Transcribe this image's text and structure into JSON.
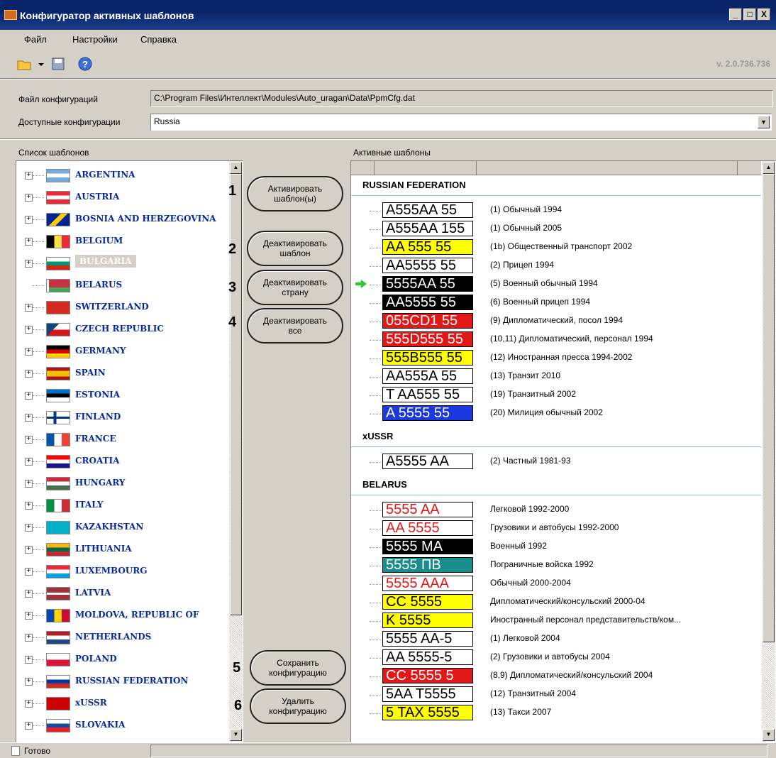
{
  "window": {
    "title": "Конфигуратор активных шаблонов",
    "min": "_",
    "max": "□",
    "close": "X"
  },
  "menu": [
    {
      "label": "Файл"
    },
    {
      "label": "Настройки"
    },
    {
      "label": "Справка"
    }
  ],
  "toolbar": {
    "version": "v. 2.0.736.736"
  },
  "config": {
    "file_label": "Файл конфигураций",
    "file_value": "C:\\Program Files\\Интеллект\\Modules\\Auto_uragan\\Data\\PpmCfg.dat",
    "available_label": "Доступные конфигурации",
    "available_value": "Russia"
  },
  "templates": {
    "label": "Список шаблонов",
    "items": [
      {
        "name": "ARGENTINA",
        "flag": "argentina",
        "expandable": true
      },
      {
        "name": "AUSTRIA",
        "flag": "austria",
        "expandable": true
      },
      {
        "name": "BOSNIA AND HERZEGOVINA",
        "flag": "bosnia",
        "expandable": true
      },
      {
        "name": "BELGIUM",
        "flag": "belgium",
        "expandable": true
      },
      {
        "name": "BULGARIA",
        "flag": "bulgaria",
        "expandable": true,
        "selected": true
      },
      {
        "name": "BELARUS",
        "flag": "belarus",
        "expandable": false
      },
      {
        "name": "SWITZERLAND",
        "flag": "switzerland",
        "expandable": true
      },
      {
        "name": "CZECH REPUBLIC",
        "flag": "czech",
        "expandable": true
      },
      {
        "name": "GERMANY",
        "flag": "germany",
        "expandable": true
      },
      {
        "name": "SPAIN",
        "flag": "spain",
        "expandable": true
      },
      {
        "name": "ESTONIA",
        "flag": "estonia",
        "expandable": true
      },
      {
        "name": "FINLAND",
        "flag": "finland",
        "expandable": true
      },
      {
        "name": "FRANCE",
        "flag": "france",
        "expandable": true
      },
      {
        "name": "CROATIA",
        "flag": "croatia",
        "expandable": true
      },
      {
        "name": "HUNGARY",
        "flag": "hungary",
        "expandable": true
      },
      {
        "name": "ITALY",
        "flag": "italy",
        "expandable": true
      },
      {
        "name": "KAZAKHSTAN",
        "flag": "kazakhstan",
        "expandable": true
      },
      {
        "name": "LITHUANIA",
        "flag": "lithuania",
        "expandable": true
      },
      {
        "name": "LUXEMBOURG",
        "flag": "luxembourg",
        "expandable": true
      },
      {
        "name": "LATVIA",
        "flag": "latvia",
        "expandable": true
      },
      {
        "name": "MOLDOVA, REPUBLIC OF",
        "flag": "moldova",
        "expandable": true
      },
      {
        "name": "NETHERLANDS",
        "flag": "netherlands",
        "expandable": true
      },
      {
        "name": "POLAND",
        "flag": "poland",
        "expandable": true
      },
      {
        "name": "RUSSIAN FEDERATION",
        "flag": "russia",
        "expandable": true
      },
      {
        "name": "xUSSR",
        "flag": "ussr",
        "expandable": true
      },
      {
        "name": "SLOVAKIA",
        "flag": "slovakia",
        "expandable": true
      }
    ]
  },
  "buttons": {
    "activate": "Активировать шаблон(ы)",
    "deactivate_template": "Деактивировать шаблон",
    "deactivate_country": "Деактивировать страну",
    "deactivate_all": "Деактивировать все",
    "save": "Сохранить конфигурацию",
    "delete": "Удалить конфигурацию"
  },
  "numbers": [
    "1",
    "2",
    "3",
    "4",
    "5",
    "6"
  ],
  "active": {
    "label": "Активные шаблоны",
    "groups": [
      {
        "title": "RUSSIAN FEDERATION",
        "items": [
          {
            "plate": "A555AA 55",
            "desc": "(1) Обычный 1994",
            "bg": "#ffffff",
            "fg": "#000000"
          },
          {
            "plate": "A555AA 155",
            "desc": "(1) Обычный 2005",
            "bg": "#ffffff",
            "fg": "#000000"
          },
          {
            "plate": "AA 555 55",
            "desc": "(1b) Общественный транспорт 2002",
            "bg": "#ffff00",
            "fg": "#000000"
          },
          {
            "plate": "AA5555 55",
            "desc": "(2) Прицеп 1994",
            "bg": "#ffffff",
            "fg": "#000000"
          },
          {
            "plate": "5555AA 55",
            "desc": "(5) Военный обычный 1994",
            "bg": "#000000",
            "fg": "#ffffff",
            "arrow": true
          },
          {
            "plate": "AA5555 55",
            "desc": "(6) Военный прицеп 1994",
            "bg": "#000000",
            "fg": "#ffffff"
          },
          {
            "plate": "055CD1 55",
            "desc": "(9) Дипломатический, посол 1994",
            "bg": "#e01818",
            "fg": "#ffffff"
          },
          {
            "plate": "555D555 55",
            "desc": "(10,11) Дипломатический, персонал 1994",
            "bg": "#e01818",
            "fg": "#ffffff"
          },
          {
            "plate": "555B555 55",
            "desc": "(12) Иностранная пресса 1994-2002",
            "bg": "#ffff00",
            "fg": "#000000"
          },
          {
            "plate": "AA555A 55",
            "desc": "(13) Транзит 2010",
            "bg": "#ffffff",
            "fg": "#000000"
          },
          {
            "plate": "T AA555 55",
            "desc": "(19) Транзитный 2002",
            "bg": "#ffffff",
            "fg": "#000000"
          },
          {
            "plate": "A 5555 55",
            "desc": "(20) Милиция обычный 2002",
            "bg": "#1a3ae0",
            "fg": "#ffffff"
          }
        ]
      },
      {
        "title": "xUSSR",
        "items": [
          {
            "plate": "A5555 AA",
            "desc": "(2) Частный 1981-93",
            "bg": "#ffffff",
            "fg": "#000000"
          }
        ]
      },
      {
        "title": "BELARUS",
        "items": [
          {
            "plate": "5555 AA",
            "desc": "Легковой 1992-2000",
            "bg": "#ffffff",
            "fg": "#e01818"
          },
          {
            "plate": "AA 5555",
            "desc": "Грузовики и автобусы 1992-2000",
            "bg": "#ffffff",
            "fg": "#e01818"
          },
          {
            "plate": "5555 MA",
            "desc": "Военный 1992",
            "bg": "#000000",
            "fg": "#ffffff"
          },
          {
            "plate": "5555 ПВ",
            "desc": "Пограничные войска 1992",
            "bg": "#1a8c8c",
            "fg": "#ffffff"
          },
          {
            "plate": "5555 AAA",
            "desc": "Обычный 2000-2004",
            "bg": "#ffffff",
            "fg": "#e01818"
          },
          {
            "plate": "CC 5555",
            "desc": "Дипломатический/консульский 2000-04",
            "bg": "#ffff00",
            "fg": "#000000"
          },
          {
            "plate": "K 5555",
            "desc": "Иностранный персонал представительств/ком...",
            "bg": "#ffff00",
            "fg": "#000000"
          },
          {
            "plate": "5555 AA-5",
            "desc": "(1) Легковой 2004",
            "bg": "#ffffff",
            "fg": "#000000"
          },
          {
            "plate": "AA 5555-5",
            "desc": "(2) Грузовики и автобусы 2004",
            "bg": "#ffffff",
            "fg": "#000000"
          },
          {
            "plate": "CC 5555 5",
            "desc": "(8,9) Дипломатический/консульский 2004",
            "bg": "#e01818",
            "fg": "#ffffff"
          },
          {
            "plate": "5AA T5555",
            "desc": "(12) Транзитный 2004",
            "bg": "#ffffff",
            "fg": "#000000"
          },
          {
            "plate": "5 TAX 5555",
            "desc": "(13) Такси 2007",
            "bg": "#ffff00",
            "fg": "#000000"
          }
        ]
      }
    ]
  },
  "status": {
    "text": "Готово"
  }
}
